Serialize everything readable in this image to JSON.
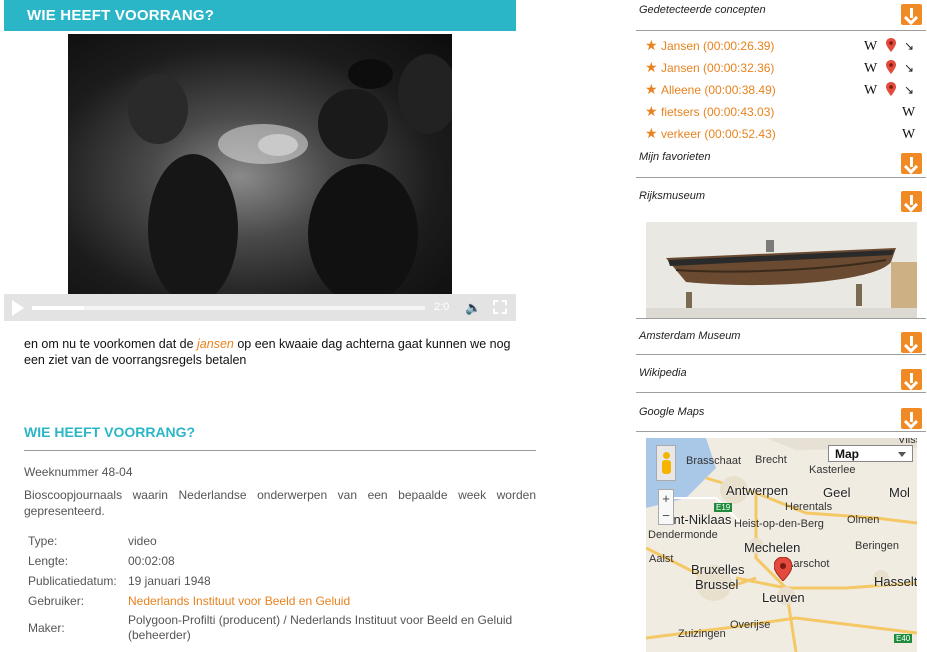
{
  "header": {
    "title": "WIE HEEFT VOORRANG?"
  },
  "video": {
    "time": "2:0"
  },
  "subtitle": {
    "before": "en om nu te voorkomen dat de ",
    "highlight": "jansen",
    "after": " op een kwaaie dag achterna gaat kunnen we nog een ziet van de voorrangsregels betalen"
  },
  "details": {
    "heading": "WIE HEEFT VOORRANG?",
    "week": "Weeknummer 48-04",
    "description": "Bioscoopjournaals waarin Nederlandse onderwerpen van een bepaalde week worden gepresenteerd.",
    "rows": [
      {
        "key": "Type:",
        "value": "video"
      },
      {
        "key": "Lengte:",
        "value": "00:02:08"
      },
      {
        "key": "Publicatiedatum:",
        "value": "19 januari 1948"
      },
      {
        "key": "Gebruiker:",
        "value": "Nederlands Instituut voor Beeld en Geluid"
      },
      {
        "key": "Maker:",
        "value": "Polygoon-Profilti (producent) / Nederlands Instituut voor Beeld en Geluid (beheerder)"
      }
    ]
  },
  "sidebar": {
    "detected_label": "Gedetecteerde concepten",
    "concepts": [
      {
        "label": "Jansen (00:00:26.39)",
        "wiki_icon": "W",
        "has_map": true,
        "has_link": true
      },
      {
        "label": "Jansen (00:00:32.36)",
        "wiki_icon": "W",
        "has_map": true,
        "has_link": true
      },
      {
        "label": "Alleene (00:00:38.49)",
        "wiki_icon": "W",
        "has_map": true,
        "has_link": true
      },
      {
        "label": "fietsers (00:00:43.03)",
        "wiki_icon": "W",
        "has_map": false,
        "has_link": false
      },
      {
        "label": "verkeer (00:00:52.43)",
        "wiki_icon": "W",
        "has_map": false,
        "has_link": false
      }
    ],
    "favorites_label": "Mijn favorieten",
    "rijks_label": "Rijksmuseum",
    "amsterdam_label": "Amsterdam Museum",
    "wikipedia_label": "Wikipedia",
    "maps_label": "Google Maps",
    "map": {
      "type_label": "Map",
      "zoom_in": "+",
      "zoom_out": "−",
      "places": [
        "Vlissingen",
        "Brasschaat",
        "Brecht",
        "Kasterlee",
        "Antwerpen",
        "Geel",
        "Mol",
        "Herentals",
        "Sint-Niklaas",
        "Heist-op-den-Berg",
        "Olmen",
        "Dendermonde",
        "Mechelen",
        "Beringen",
        "Aarschot",
        "Aalst",
        "Bruxelles",
        "Brussel",
        "Hasselt",
        "Leuven",
        "Overijse",
        "Zuizingen"
      ],
      "roads": [
        "E19",
        "E40"
      ]
    }
  },
  "colors": {
    "accent": "#2bb6c8",
    "orange": "#f08a24",
    "link": "#e8821e"
  }
}
